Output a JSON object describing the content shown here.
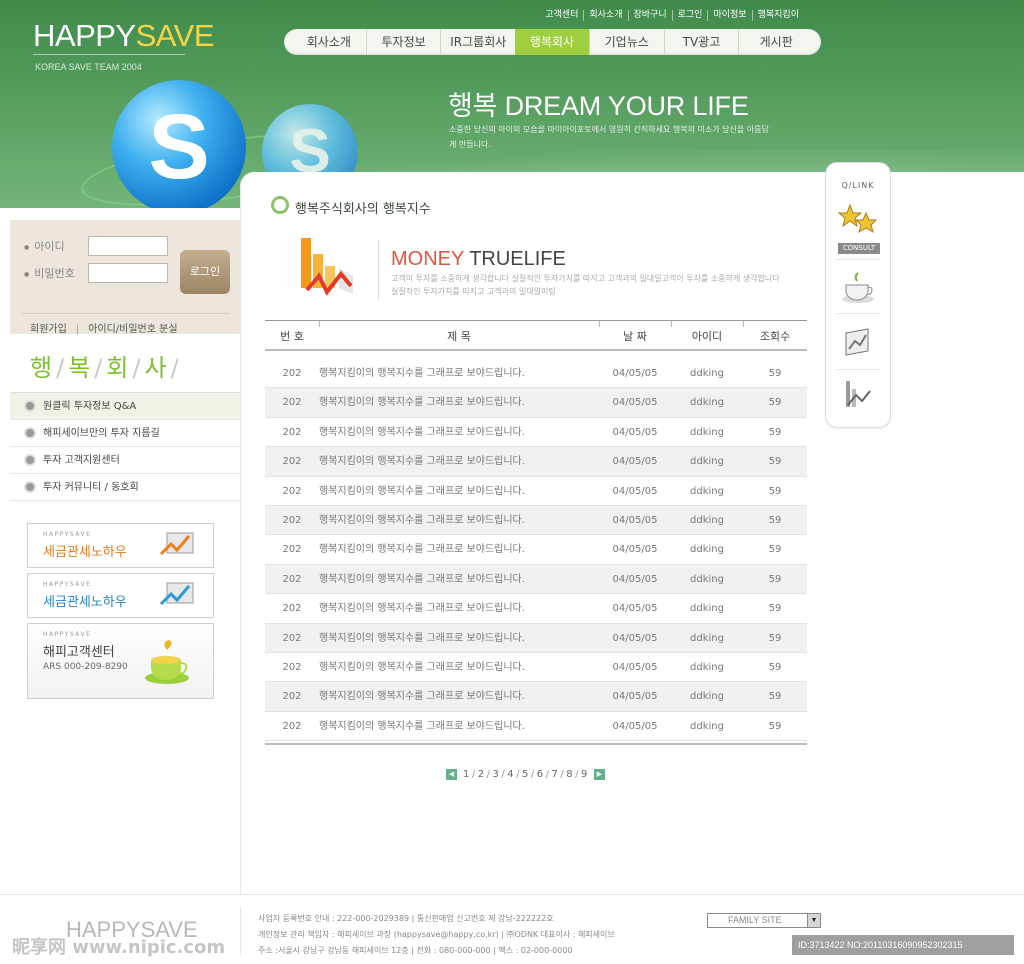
{
  "header": {
    "logo_main": "HAPPY",
    "logo_accent": "SAVE",
    "logo_sub": "KOREA SAVE TEAM 2004",
    "top_links": [
      "고객센터",
      "회사소개",
      "장바구니",
      "로그인",
      "마이정보",
      "행복지킴이"
    ],
    "gnb": [
      "회사소개",
      "투자정보",
      "IR그룹회사",
      "행복회사",
      "기업뉴스",
      "TV광고",
      "게시판"
    ],
    "gnb_active_index": 3,
    "ball_letter": "S",
    "slogan": "행복 DREAM YOUR LIFE",
    "slogan_desc": "소중한 당신의 아이의 모습을 마이아이포토에서 영원히 간직하세요  행복의 미소가 당신을 아름답게 만듭니다."
  },
  "login": {
    "id_label": "아이디",
    "pw_label": "비밀번호",
    "button": "로그인",
    "links": [
      "회원가입",
      "아이디/비밀번호 분실"
    ]
  },
  "side": {
    "title_chars": [
      "행",
      "복",
      "회",
      "사"
    ],
    "menu": [
      "원클릭 투자정보 Q&A",
      "해피세이브만의 투자 지름길",
      "투자 고객지원센터",
      "투자 커뮤니티 / 동호회"
    ],
    "banners": [
      {
        "small": "HAPPYSAVE",
        "title": "세금관세노하우",
        "color": "#e07d1e"
      },
      {
        "small": "HAPPYSAVE",
        "title": "세금관세노하우",
        "color": "#2a86c2"
      },
      {
        "small": "HAPPYSAVE",
        "title": "해피고객센터",
        "sub": "ARS 000-209-8290",
        "color": "#444444"
      }
    ]
  },
  "main": {
    "section_title": "행복주식회사의 행복지수",
    "money_title_a": "MONEY",
    "money_title_b": "TRUELIFE",
    "money_desc": "고객이 투자를 소중하게 생각합니다 실질적인 투자가치를 따지고 고객과의 일대일고객이 투자를 소중하게 생각합니다 실질적인 투자가치를 따지고 고객과의 일대일미팅",
    "columns": [
      "번 호",
      "제 목",
      "날 짜",
      "아이디",
      "조회수"
    ],
    "rows": [
      {
        "no": "202",
        "title": "행복지킴이의 행복지수를 그래프로 보야드립니다.",
        "date": "04/05/05",
        "id": "ddking",
        "views": "59"
      },
      {
        "no": "202",
        "title": "행복지킴이의 행복지수를 그래프로 보야드립니다.",
        "date": "04/05/05",
        "id": "ddking",
        "views": "59"
      },
      {
        "no": "202",
        "title": "행복지킴이의 행복지수를 그래프로 보야드립니다.",
        "date": "04/05/05",
        "id": "ddking",
        "views": "59"
      },
      {
        "no": "202",
        "title": "행복지킴이의 행복지수를 그래프로 보야드립니다.",
        "date": "04/05/05",
        "id": "ddking",
        "views": "59"
      },
      {
        "no": "202",
        "title": "행복지킴이의 행복지수를 그래프로 보야드립니다.",
        "date": "04/05/05",
        "id": "ddking",
        "views": "59"
      },
      {
        "no": "202",
        "title": "행복지킴이의 행복지수를 그래프로 보야드립니다.",
        "date": "04/05/05",
        "id": "ddking",
        "views": "59"
      },
      {
        "no": "202",
        "title": "행복지킴이의 행복지수를 그래프로 보야드립니다.",
        "date": "04/05/05",
        "id": "ddking",
        "views": "59"
      },
      {
        "no": "202",
        "title": "행복지킴이의 행복지수를 그래프로 보야드립니다.",
        "date": "04/05/05",
        "id": "ddking",
        "views": "59"
      },
      {
        "no": "202",
        "title": "행복지킴이의 행복지수를 그래프로 보야드립니다.",
        "date": "04/05/05",
        "id": "ddking",
        "views": "59"
      },
      {
        "no": "202",
        "title": "행복지킴이의 행복지수를 그래프로 보야드립니다.",
        "date": "04/05/05",
        "id": "ddking",
        "views": "59"
      },
      {
        "no": "202",
        "title": "행복지킴이의 행복지수를 그래프로 보야드립니다.",
        "date": "04/05/05",
        "id": "ddking",
        "views": "59"
      },
      {
        "no": "202",
        "title": "행복지킴이의 행복지수를 그래프로 보야드립니다.",
        "date": "04/05/05",
        "id": "ddking",
        "views": "59"
      },
      {
        "no": "202",
        "title": "행복지킴이의 행복지수를 그래프로 보야드립니다.",
        "date": "04/05/05",
        "id": "ddking",
        "views": "59"
      }
    ],
    "pages": [
      "1",
      "2",
      "3",
      "4",
      "5",
      "6",
      "7",
      "8",
      "9"
    ]
  },
  "quick": {
    "title": "Q/LINK",
    "consult": "CONSULT",
    "icons": [
      "stars-icon",
      "coffee-cup-icon",
      "monitor-chart-icon",
      "cursor-chart-icon"
    ]
  },
  "footer": {
    "logo": "HAPPYSAVE",
    "lines": [
      "사업자 등록번호 안내 : 222-000-2029389 | 통신판매업 신고번호 제 강남-222222호",
      "개인정보 관리 책임자 : 해피세이브 과장 (happysave@happy,co,kr) | ㈜ODNK 대표이사 : 해피세이브",
      "주소 :서울시 강남구 강남동 해피세이브 12층 | 전화 : 080-000-000 | 팩스 : 02-000-0000"
    ],
    "family_site": "FAMILY SITE",
    "watermark_left": "昵享网 www.nipic.com",
    "watermark_right": "ID:3713422 NO:20110316090952302315"
  }
}
